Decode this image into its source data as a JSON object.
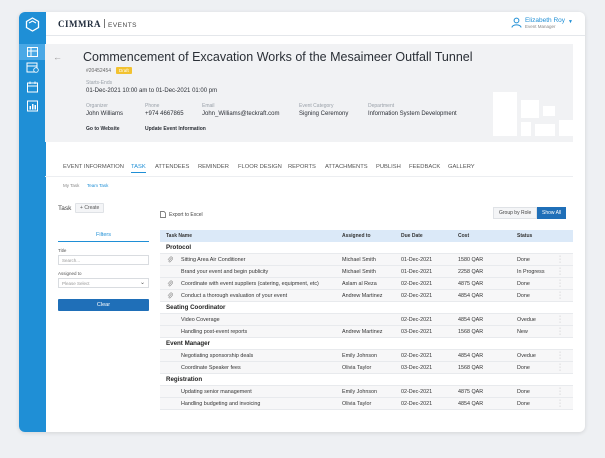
{
  "app": {
    "brand": "CIMMRA",
    "brand_sub": "EVENTS"
  },
  "user": {
    "name": "Elizabeth Roy",
    "role": "Event Manager"
  },
  "event": {
    "title": "Commencement of Excavation Works of the Mesaimeer Outfall Tunnel",
    "id": "#20452454",
    "status_badge": "Draft",
    "starts_ends_label": "Starts-Ends",
    "starts_ends": "01-Dec-2021 10:00 am to 01-Dec-2021 01:00 pm",
    "fields": [
      {
        "label": "Organizer",
        "value": "John Williams"
      },
      {
        "label": "Phone",
        "value": "+974 4667865"
      },
      {
        "label": "Email",
        "value": "John_Williams@teckraft.com"
      },
      {
        "label": "Event Category",
        "value": "Signing Ceremony"
      },
      {
        "label": "Department",
        "value": "Information System Development"
      }
    ],
    "go_to_website": "Go to Website",
    "update_info": "Update Event Information"
  },
  "tabs": [
    "EVENT INFORMATION",
    "TASK",
    "ATTENDEES",
    "REMINDER",
    "FLOOR DESIGN",
    "REPORTS",
    "ATTACHMENTS",
    "PUBLISH",
    "FEEDBACK",
    "GALLERY"
  ],
  "active_tab": "TASK",
  "subtabs": [
    "My Task",
    "Team Task"
  ],
  "task": {
    "label": "Task",
    "create": "Create",
    "export": "Export to Excel",
    "group_by_role": "Group by Role",
    "show_all": "Show All"
  },
  "filters": {
    "tab": "Filters",
    "title_label": "Title",
    "title_placeholder": "Search...",
    "assigned_label": "Assigned to",
    "assigned_placeholder": "Please Select",
    "clear": "Clear"
  },
  "table": {
    "headers": [
      "Task Name",
      "Assigned to",
      "Due Date",
      "Cost",
      "Status"
    ],
    "groups": [
      {
        "name": "Protocol",
        "rows": [
          {
            "task": "Sitting Area Air Conditioner",
            "assigned": "Michael Smith",
            "due": "01-Dec-2021",
            "cost": "1580 QAR",
            "status": "Done",
            "attachment": true
          },
          {
            "task": "Brand your event and begin publicity",
            "assigned": "Michael Smith",
            "due": "01-Dec-2021",
            "cost": "2258 QAR",
            "status": "In Progress",
            "attachment": false
          },
          {
            "task": "Coordinate with event suppliers (catering, equipment, etc)",
            "assigned": "Aslam al Reza",
            "due": "02-Dec-2021",
            "cost": "4875 QAR",
            "status": "Done",
            "attachment": true
          },
          {
            "task": "Conduct a thorough evaluation of your event",
            "assigned": "Andrew Martinez",
            "due": "02-Dec-2021",
            "cost": "4854 QAR",
            "status": "Done",
            "attachment": true
          }
        ]
      },
      {
        "name": "Seating Coordinator",
        "rows": [
          {
            "task": "Video Coverage",
            "assigned": "",
            "due": "02-Dec-2021",
            "cost": "4854 QAR",
            "status": "Ovedue",
            "attachment": false
          },
          {
            "task": "Handling post-event reports",
            "assigned": "Andrew Martinez",
            "due": "03-Dec-2021",
            "cost": "1568 QAR",
            "status": "New",
            "attachment": false
          }
        ]
      },
      {
        "name": "Event Manager",
        "rows": [
          {
            "task": "Negotiating sponsorship deals",
            "assigned": "Emily Johnson",
            "due": "02-Dec-2021",
            "cost": "4854 QAR",
            "status": "Ovedue",
            "attachment": false
          },
          {
            "task": "Coordinate Speaker fees",
            "assigned": "Olivia Taylor",
            "due": "03-Dec-2021",
            "cost": "1568 QAR",
            "status": "Done",
            "attachment": false
          }
        ]
      },
      {
        "name": "Registration",
        "rows": [
          {
            "task": "Updating senior management",
            "assigned": "Emily Johnson",
            "due": "02-Dec-2021",
            "cost": "4875 QAR",
            "status": "Done",
            "attachment": false
          },
          {
            "task": "Handling budgeting and invoicing",
            "assigned": "Olivia Taylor",
            "due": "02-Dec-2021",
            "cost": "4854 QAR",
            "status": "Done",
            "attachment": false
          }
        ]
      }
    ]
  },
  "colors": {
    "primary": "#1f8fd6",
    "button": "#1f6fb8",
    "badge": "#f2c230",
    "header_row": "#dbe9f8"
  }
}
